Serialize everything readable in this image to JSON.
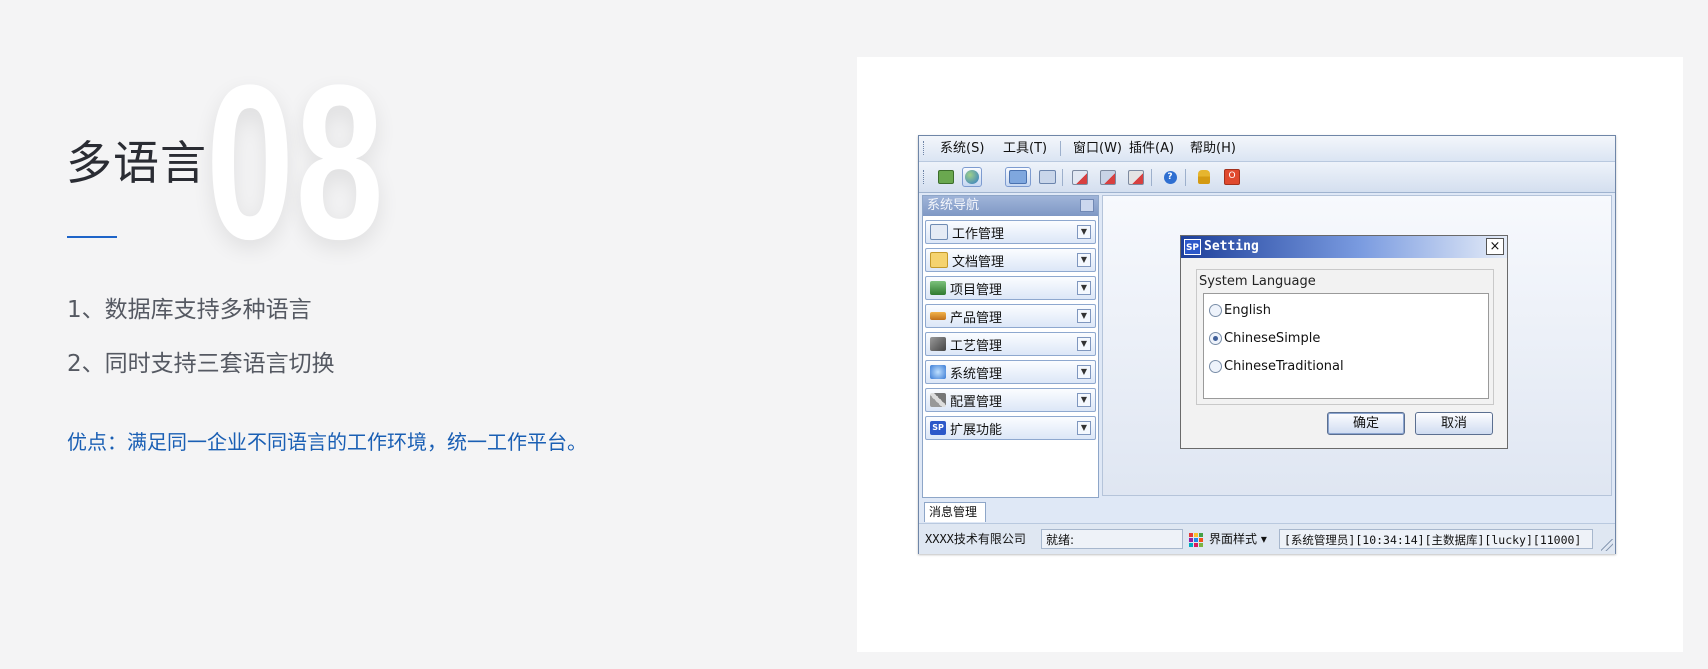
{
  "slide": {
    "number": "08",
    "title": "多语言",
    "points": [
      "1、数据库支持多种语言",
      "2、同时支持三套语言切换"
    ],
    "advantage": "优点：满足同一企业不同语言的工作环境，统一工作平台。"
  },
  "app": {
    "menu": [
      "系统(S)",
      "工具(T)",
      "窗口(W)",
      "插件(A)",
      "帮助(H)"
    ],
    "toolbar_icons": [
      "new-window-icon",
      "globe-icon",
      "folder-icon",
      "form-icon",
      "delete-doc-icon",
      "delete-list-icon",
      "delete-grid-icon",
      "help-icon",
      "lock-icon",
      "power-icon"
    ],
    "nav": {
      "header": "系统导航",
      "items": [
        {
          "label": "工作管理",
          "icon": "work-icon",
          "color": "#6f8bb3"
        },
        {
          "label": "文档管理",
          "icon": "folder-icon",
          "color": "#e8b93a"
        },
        {
          "label": "项目管理",
          "icon": "project-icon",
          "color": "#3e8e3e"
        },
        {
          "label": "产品管理",
          "icon": "product-icon",
          "color": "#d58a1c"
        },
        {
          "label": "工艺管理",
          "icon": "process-icon",
          "color": "#5b5b5b"
        },
        {
          "label": "系统管理",
          "icon": "system-icon",
          "color": "#3a7bd5"
        },
        {
          "label": "配置管理",
          "icon": "tools-icon",
          "color": "#7a7a7a"
        },
        {
          "label": "扩展功能",
          "icon": "sp-logo-icon",
          "color": "#2c58c9"
        }
      ]
    },
    "dialog": {
      "logo": "SP",
      "title": "Setting",
      "close": "×",
      "group_label": "System Language",
      "options": [
        {
          "label": "English",
          "selected": false
        },
        {
          "label": "ChineseSimple",
          "selected": true
        },
        {
          "label": "ChineseTraditional",
          "selected": false
        }
      ],
      "ok": "确定",
      "cancel": "取消"
    },
    "message_tab": "消息管理",
    "status": {
      "company": "XXXX技术有限公司",
      "ready": "就绪:",
      "style": "界面样式 ▾",
      "info": "[系统管理员][10:34:14][主数据库][lucky][11000]"
    },
    "colors": {
      "accent": "#1e64c8",
      "advantage_text": "#1a5fb4"
    }
  }
}
